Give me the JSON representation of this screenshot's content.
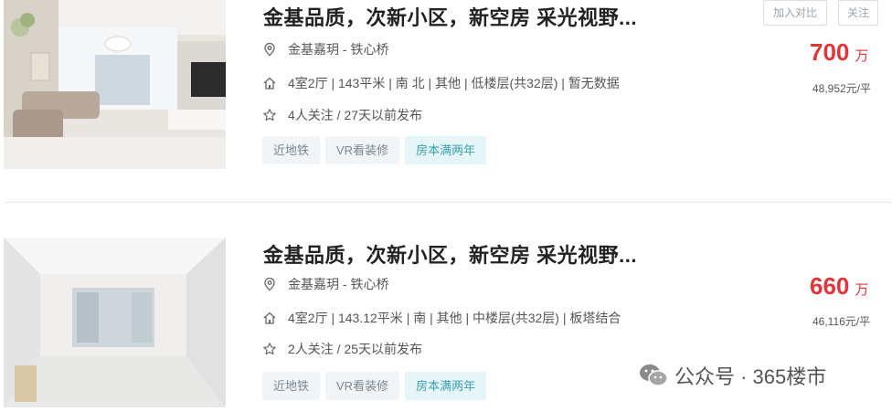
{
  "listings": [
    {
      "title": "金基品质，次新小区，新空房 采光视野...",
      "location": "金基嘉玥 - 铁心桥",
      "info": "4室2厅 | 143平米 | 南 北 | 其他 | 低楼层(共32层) | 暂无数据",
      "follow": "4人关注 / 27天以前发布",
      "tags": [
        "近地铁",
        "VR看装修",
        "房本满两年"
      ],
      "price": "700",
      "price_unit": "万",
      "unit_price": "48,952元/平",
      "compare_label": "加入对比",
      "follow_label": "关注"
    },
    {
      "title": "金基品质，次新小区，新空房 采光视野...",
      "location": "金基嘉玥 - 铁心桥",
      "info": "4室2厅 | 143.12平米 | 南 | 其他 | 中楼层(共32层) | 板塔结合",
      "follow": "2人关注 / 25天以前发布",
      "tags": [
        "近地铁",
        "VR看装修",
        "房本满两年"
      ],
      "price": "660",
      "price_unit": "万",
      "unit_price": "46,116元/平"
    }
  ],
  "watermark": "公众号 · 365楼市",
  "icons": {
    "location": "location-pin-icon",
    "house": "house-icon",
    "star": "star-icon",
    "wechat": "wechat-icon"
  },
  "colors": {
    "price": "#e0363a",
    "tag_bg": "#f2f5f7",
    "tag_highlight_bg": "#e6f6f8",
    "tag_highlight_text": "#3a9fb0"
  }
}
